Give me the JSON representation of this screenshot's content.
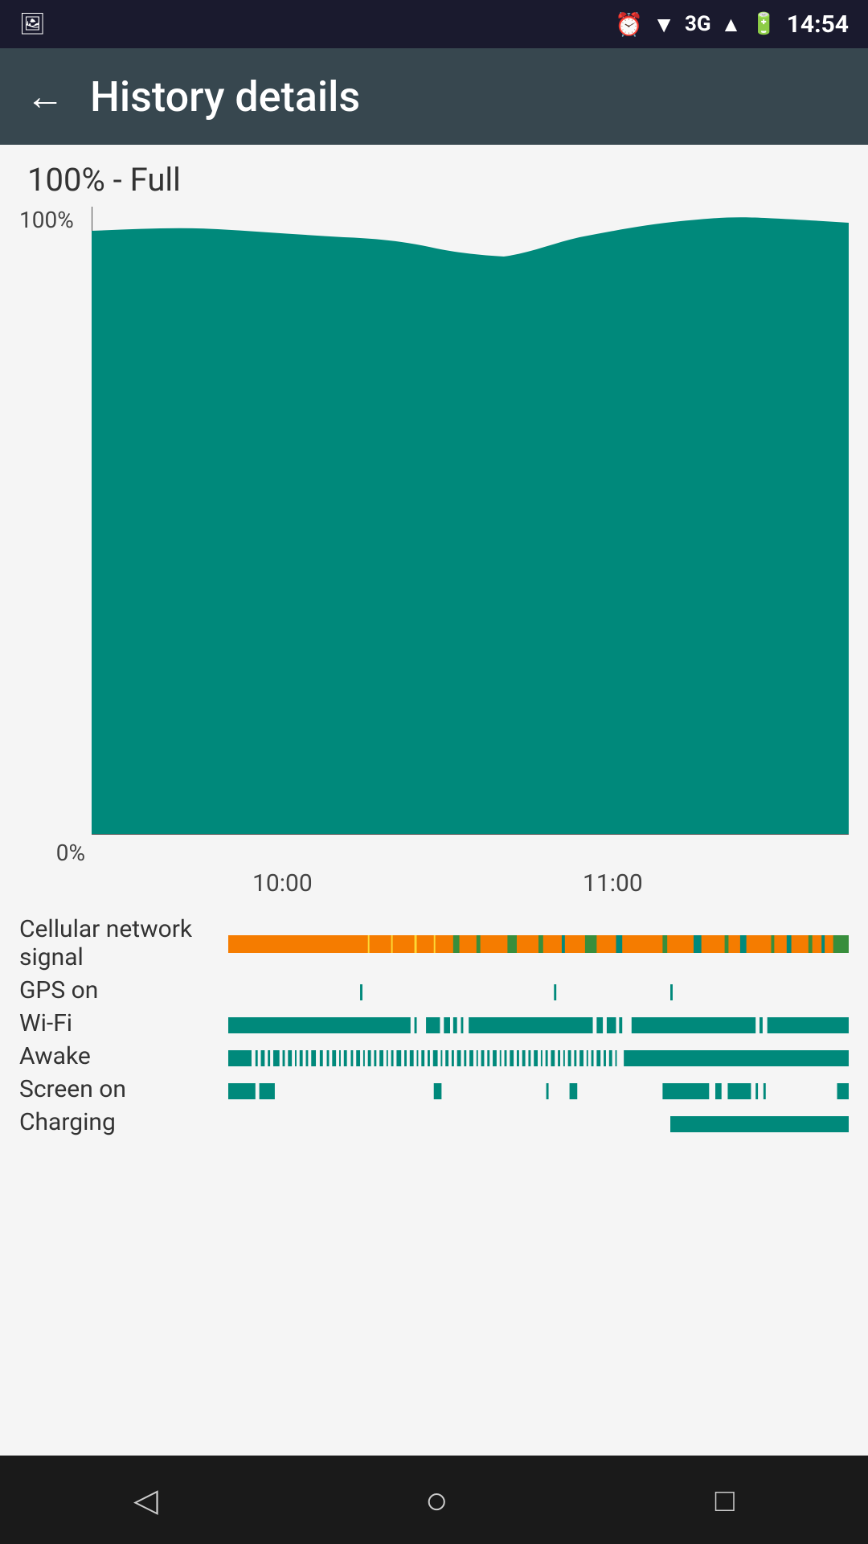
{
  "statusBar": {
    "time": "14:54",
    "network": "3G",
    "icons": [
      "image",
      "alarm",
      "wifi",
      "signal",
      "battery"
    ]
  },
  "appBar": {
    "title": "History details",
    "backLabel": "←"
  },
  "batteryStatus": "100% - Full",
  "chart": {
    "yLabels": {
      "top": "100%",
      "bottom": "0%"
    },
    "xLabels": [
      "10:00",
      "11:00"
    ],
    "color": "#00897b"
  },
  "timelines": [
    {
      "label": "Cellular network signal",
      "type": "cellular"
    },
    {
      "label": "GPS on",
      "type": "gps"
    },
    {
      "label": "Wi-Fi",
      "type": "wifi"
    },
    {
      "label": "Awake",
      "type": "awake"
    },
    {
      "label": "Screen on",
      "type": "screen"
    },
    {
      "label": "Charging",
      "type": "charging"
    }
  ],
  "bottomNav": {
    "back": "◁",
    "home": "○",
    "recent": "□"
  }
}
